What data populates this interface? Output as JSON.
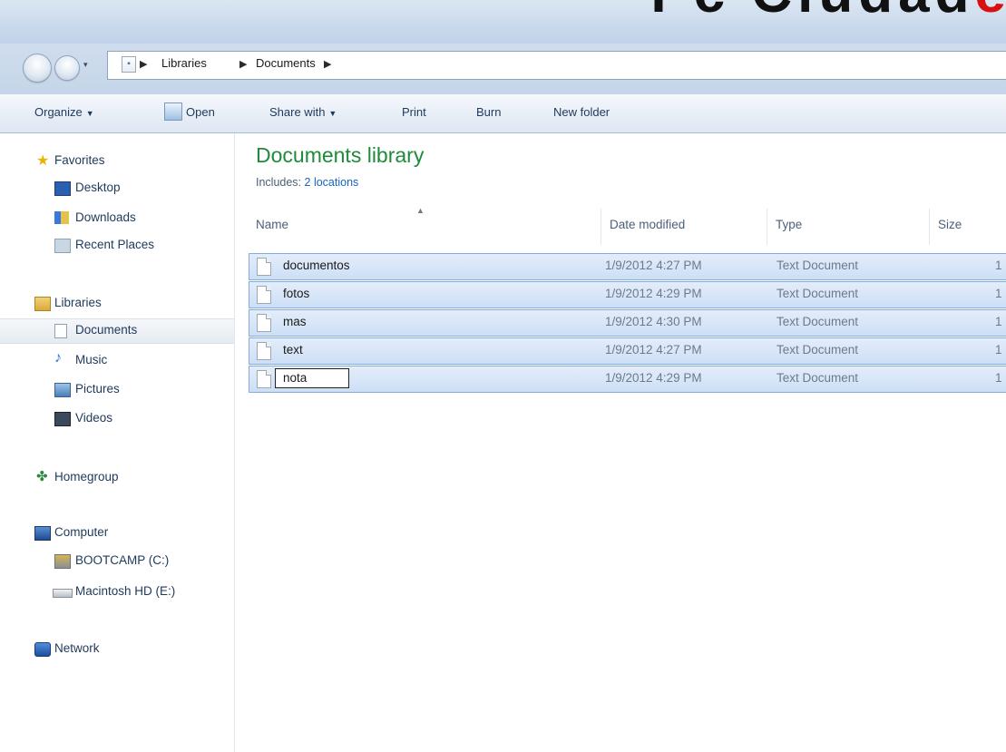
{
  "window": {
    "watermark_left": "Pc Ciudad",
    "watermark_right": "e"
  },
  "address": {
    "crumbs": [
      "Libraries",
      "Documents"
    ]
  },
  "toolbar": {
    "organize": "Organize",
    "open": "Open",
    "share_with": "Share with",
    "print": "Print",
    "burn": "Burn",
    "new_folder": "New folder"
  },
  "nav": {
    "favorites": "Favorites",
    "desktop": "Desktop",
    "downloads": "Downloads",
    "recent_places": "Recent Places",
    "libraries": "Libraries",
    "documents": "Documents",
    "music": "Music",
    "pictures": "Pictures",
    "videos": "Videos",
    "homegroup": "Homegroup",
    "computer": "Computer",
    "bootcamp": "BOOTCAMP (C:)",
    "macintosh": "Macintosh HD (E:)",
    "network": "Network"
  },
  "main": {
    "title": "Documents library",
    "includes_label": "Includes:",
    "includes_link": "2 locations",
    "columns": {
      "name": "Name",
      "date": "Date modified",
      "type": "Type",
      "size": "Size"
    },
    "files": [
      {
        "name": "documentos",
        "date": "1/9/2012 4:27 PM",
        "type": "Text Document",
        "size": "1"
      },
      {
        "name": "fotos",
        "date": "1/9/2012 4:29 PM",
        "type": "Text Document",
        "size": "1"
      },
      {
        "name": "mas",
        "date": "1/9/2012 4:30 PM",
        "type": "Text Document",
        "size": "1"
      },
      {
        "name": "text",
        "date": "1/9/2012 4:27 PM",
        "type": "Text Document",
        "size": "1"
      },
      {
        "name": "nota",
        "date": "1/9/2012 4:29 PM",
        "type": "Text Document",
        "size": "1"
      }
    ]
  },
  "colors": {
    "selection": "#cddff6",
    "title_green": "#1f8a3a",
    "link_blue": "#1565c0"
  }
}
